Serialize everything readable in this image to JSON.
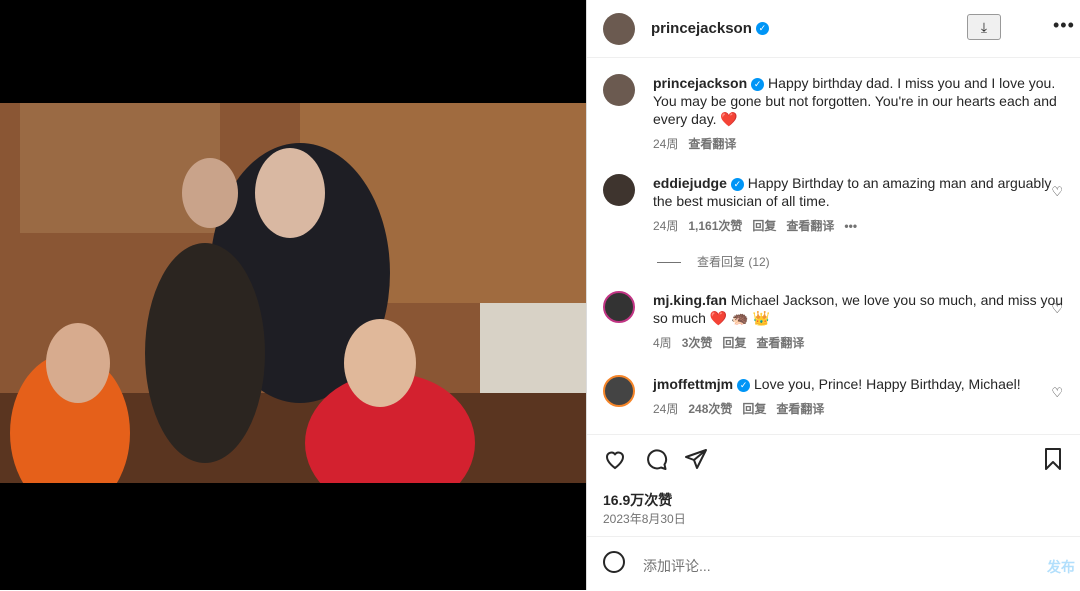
{
  "header": {
    "username": "princejackson",
    "verified": true
  },
  "comments": [
    {
      "username": "princejackson",
      "text": "Happy birthday dad. I miss you and I love you. You may be gone but not forgotten. You're in our hearts each and every day. ❤️",
      "time": "24周",
      "translate": "查看翻译"
    },
    {
      "username": "eddiejudge",
      "text": "Happy Birthday to an amazing man and arguably the best musician of all time.",
      "time": "24周",
      "likes": "1,161次赞",
      "reply": "回复",
      "translate": "查看翻译"
    },
    {
      "username": "mj.king.fan",
      "text": "Michael Jackson, we love you so much, and miss you so much ❤️ 🦔 👑",
      "time": "4周",
      "likes": "3次赞",
      "reply": "回复",
      "translate": "查看翻译"
    },
    {
      "username": "jmoffettmjm",
      "text": "Love you, Prince! Happy Birthday, Michael!",
      "time": "24周",
      "likes": "248次赞",
      "reply": "回复",
      "translate": "查看翻译"
    }
  ],
  "view_replies": "查看回复 (12)",
  "post": {
    "likes": "16.9万次赞",
    "date": "2023年8月30日"
  },
  "comment_box": {
    "placeholder": "添加评论...",
    "post_label": "发布"
  }
}
